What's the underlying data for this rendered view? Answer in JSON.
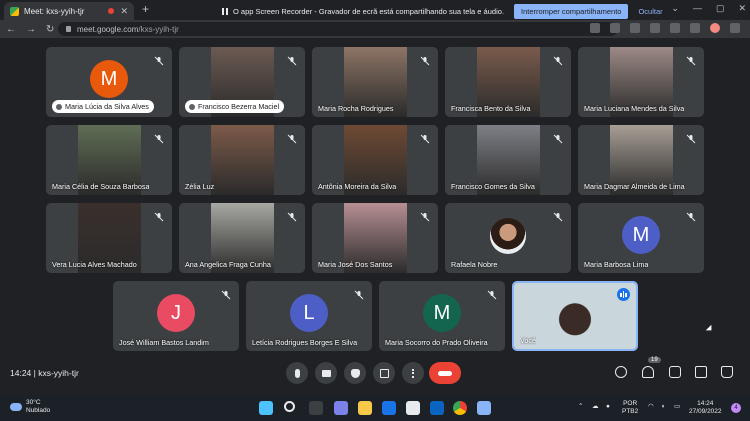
{
  "browser": {
    "tab_title": "Meet: kxs-yyih-tjr",
    "new_tab": "+",
    "url_host": "meet.google.com",
    "url_path": "/kxs-yyih-tjr",
    "share_notice": "O app Screen Recorder - Gravador de ecrã está compartilhando sua tela e áudio.",
    "stop_sharing": "Interromper compartilhamento",
    "hide": "Ocultar"
  },
  "participants": [
    {
      "name": "Maria Lúcia da Silva Alves",
      "avatar_letter": "M",
      "avatar_color": "#e8590c",
      "pill": true
    },
    {
      "name": "Francisco Bezerra Maciel",
      "pill": true,
      "video_color": "#6b5a52"
    },
    {
      "name": "Maria Rocha Rodrigues",
      "video_color": "#8d7566"
    },
    {
      "name": "Francisca Bento da Silva",
      "video_color": "#7a5b4c"
    },
    {
      "name": "Maria Luciana Mendes da Silva",
      "video_color": "#9c8a86"
    },
    {
      "name": "Maria Célia de Souza Barbosa",
      "video_color": "#5f6d55"
    },
    {
      "name": "Zélia Luz",
      "video_color": "#7c5a49"
    },
    {
      "name": "Antônia Moreira da Silva",
      "video_color": "#6e4a34"
    },
    {
      "name": "Francisco Gomes da Silva",
      "video_color": "#7e7f86"
    },
    {
      "name": "Maria Dagmar Almeida de Lima",
      "video_color": "#a79e95"
    },
    {
      "name": "Vera Lucia Alves Machado",
      "video_color": "#3a2f2c"
    },
    {
      "name": "Ana Angelica Fraga Cunha",
      "video_color": "#a7a8a2"
    },
    {
      "name": "Maria José Dos Santos",
      "video_color": "#b68f93"
    },
    {
      "name": "Rafaela Nobre",
      "photo": true
    },
    {
      "name": "Maria Barbosa Lima",
      "avatar_letter": "M",
      "avatar_color": "#4e5ec7"
    },
    {
      "name": "José William Bastos Landim",
      "avatar_letter": "J",
      "avatar_color": "#e94b63"
    },
    {
      "name": "Letícia Rodrigues Borges E Silva",
      "avatar_letter": "L",
      "avatar_color": "#4e5ec7"
    },
    {
      "name": "Maria Socorro do Prado Oliveira",
      "avatar_letter": "M",
      "avatar_color": "#13654f"
    },
    {
      "name": "Você",
      "video_color": "#c9d6dc",
      "self": true
    }
  ],
  "meeting_code": "14:24 | kxs-yyih-tjr",
  "people_count": "19",
  "icons": {
    "mic": "mic-icon",
    "camera": "camera-icon",
    "hand": "raise-hand-icon",
    "present": "present-screen-icon",
    "more": "more-options-icon",
    "hangup": "hangup-icon",
    "info": "info-icon",
    "people": "people-icon",
    "chat": "chat-icon",
    "activities": "activities-icon",
    "lock": "host-controls-icon"
  },
  "taskbar": {
    "temp": "30°C",
    "weather": "Nublado",
    "lang": "POR",
    "layout": "PTB2",
    "time": "14:24",
    "date": "27/09/2022",
    "notifications": "4"
  }
}
